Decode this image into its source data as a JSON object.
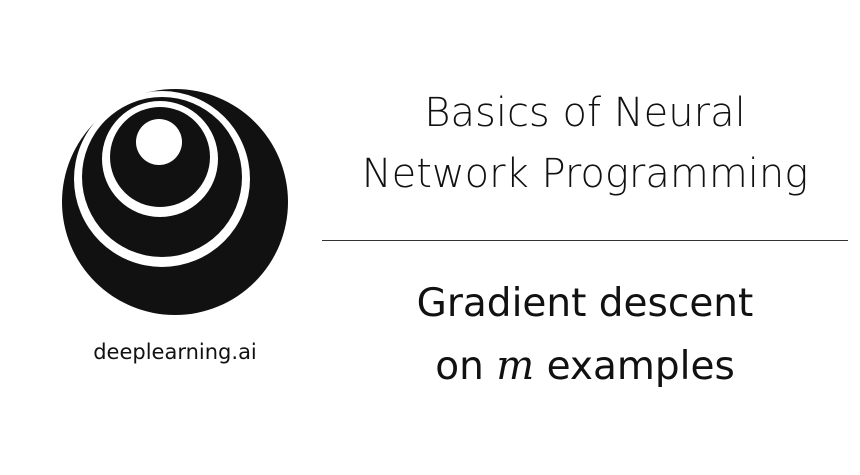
{
  "logo": {
    "icon": "deeplearning-ai-logo",
    "colors": {
      "ink": "#111111",
      "paper": "#ffffff"
    },
    "brand_text": "deeplearning.ai"
  },
  "title": {
    "line1": "Basics of Neural",
    "line2": "Network Programming"
  },
  "subtitle": {
    "line1": "Gradient descent",
    "line2_prefix": "on",
    "line2_math": "m",
    "line2_suffix": "examples"
  }
}
